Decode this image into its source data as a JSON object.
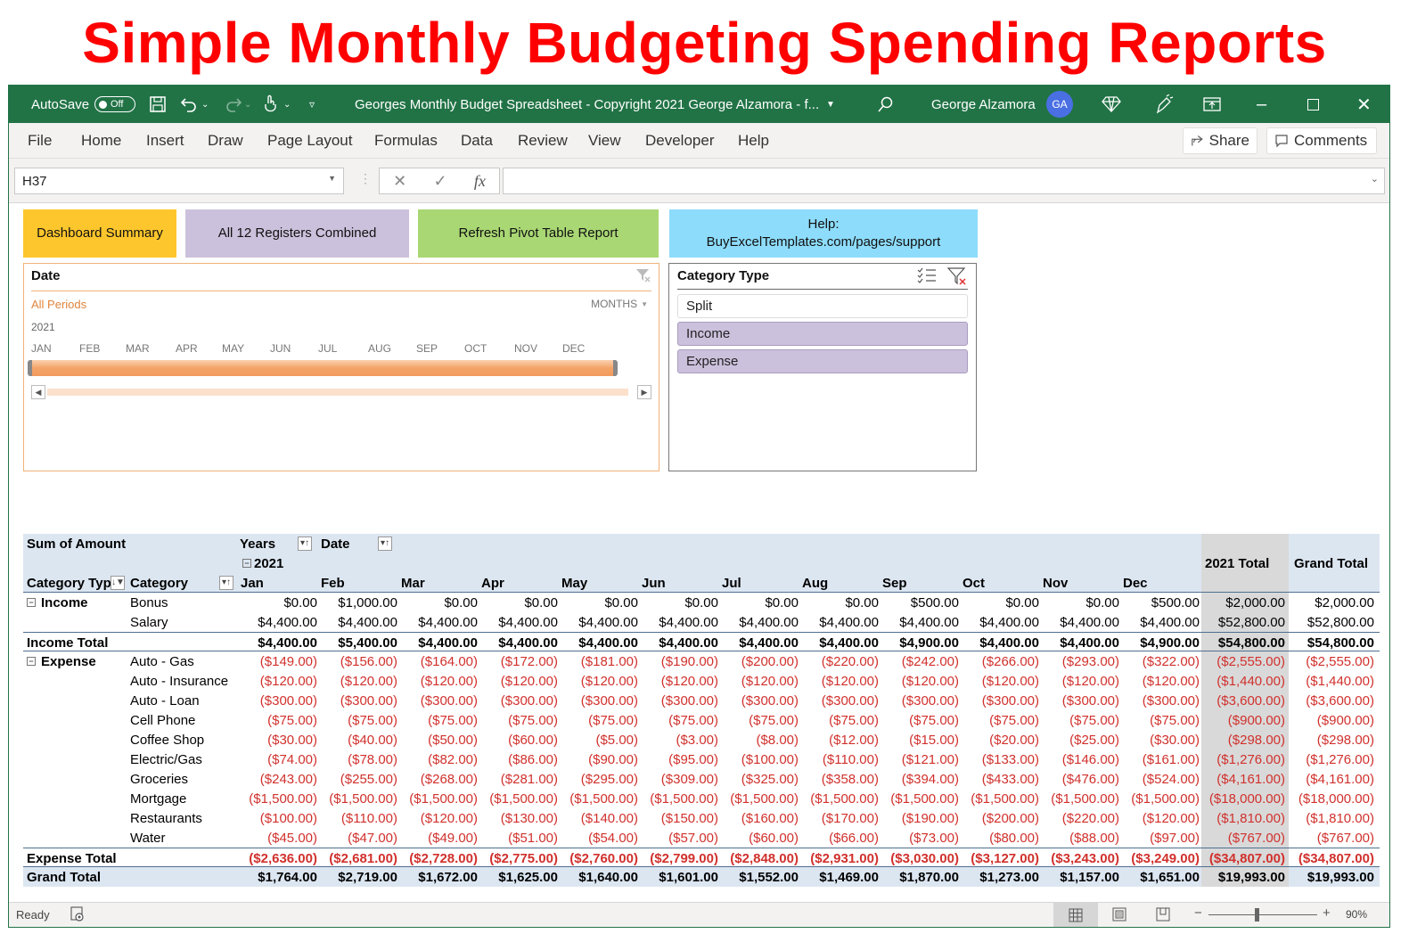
{
  "banner": {
    "title": "Simple Monthly Budgeting Spending Reports",
    "color": "#ff0000"
  },
  "titlebar": {
    "autosave_label": "AutoSave",
    "autosave_state": "Off",
    "document_title": "Georges Monthly Budget Spreadsheet - Copyright 2021 George Alzamora - f...",
    "user_name": "George Alzamora",
    "user_initials": "GA",
    "accent": "#217346"
  },
  "ribbon": {
    "tabs": [
      "File",
      "Home",
      "Insert",
      "Draw",
      "Page Layout",
      "Formulas",
      "Data",
      "Review",
      "View",
      "Developer",
      "Help"
    ],
    "share_label": "Share",
    "comments_label": "Comments"
  },
  "formula_bar": {
    "name_box": "H37",
    "fx_label": "fx",
    "formula": ""
  },
  "buttons": {
    "dashboard": "Dashboard Summary",
    "registers": "All 12 Registers Combined",
    "refresh": "Refresh Pivot Table Report",
    "help_line1": "Help:",
    "help_line2": "BuyExcelTemplates.com/pages/support"
  },
  "date_slicer": {
    "title": "Date",
    "selection": "All Periods",
    "level": "MONTHS",
    "year": "2021",
    "months": [
      "JAN",
      "FEB",
      "MAR",
      "APR",
      "MAY",
      "JUN",
      "JUL",
      "AUG",
      "SEP",
      "OCT",
      "NOV",
      "DEC"
    ],
    "selected_range": "JAN-DEC"
  },
  "category_slicer": {
    "title": "Category Type",
    "items": [
      {
        "label": "Split",
        "selected": false
      },
      {
        "label": "Income",
        "selected": true
      },
      {
        "label": "Expense",
        "selected": true
      }
    ]
  },
  "pivot": {
    "value_label": "Sum of Amount",
    "years_label": "Years",
    "date_label": "Date",
    "year": "2021",
    "row_header_1": "Category Typ",
    "row_header_2": "Category",
    "months": [
      "Jan",
      "Feb",
      "Mar",
      "Apr",
      "May",
      "Jun",
      "Jul",
      "Aug",
      "Sep",
      "Oct",
      "Nov",
      "Dec"
    ],
    "year_total_label": "2021 Total",
    "grand_total_label": "Grand Total",
    "groups": [
      {
        "name": "Income",
        "rows": [
          {
            "category": "Bonus",
            "values": [
              "$0.00",
              "$1,000.00",
              "$0.00",
              "$0.00",
              "$0.00",
              "$0.00",
              "$0.00",
              "$0.00",
              "$500.00",
              "$0.00",
              "$0.00",
              "$500.00"
            ],
            "year_total": "$2,000.00",
            "grand_total": "$2,000.00"
          },
          {
            "category": "Salary",
            "values": [
              "$4,400.00",
              "$4,400.00",
              "$4,400.00",
              "$4,400.00",
              "$4,400.00",
              "$4,400.00",
              "$4,400.00",
              "$4,400.00",
              "$4,400.00",
              "$4,400.00",
              "$4,400.00",
              "$4,400.00"
            ],
            "year_total": "$52,800.00",
            "grand_total": "$52,800.00"
          }
        ],
        "total_label": "Income Total",
        "total": {
          "values": [
            "$4,400.00",
            "$5,400.00",
            "$4,400.00",
            "$4,400.00",
            "$4,400.00",
            "$4,400.00",
            "$4,400.00",
            "$4,400.00",
            "$4,900.00",
            "$4,400.00",
            "$4,400.00",
            "$4,900.00"
          ],
          "year_total": "$54,800.00",
          "grand_total": "$54,800.00"
        },
        "negative": false
      },
      {
        "name": "Expense",
        "rows": [
          {
            "category": "Auto - Gas",
            "values": [
              "($149.00)",
              "($156.00)",
              "($164.00)",
              "($172.00)",
              "($181.00)",
              "($190.00)",
              "($200.00)",
              "($220.00)",
              "($242.00)",
              "($266.00)",
              "($293.00)",
              "($322.00)"
            ],
            "year_total": "($2,555.00)",
            "grand_total": "($2,555.00)"
          },
          {
            "category": "Auto - Insurance",
            "values": [
              "($120.00)",
              "($120.00)",
              "($120.00)",
              "($120.00)",
              "($120.00)",
              "($120.00)",
              "($120.00)",
              "($120.00)",
              "($120.00)",
              "($120.00)",
              "($120.00)",
              "($120.00)"
            ],
            "year_total": "($1,440.00)",
            "grand_total": "($1,440.00)"
          },
          {
            "category": "Auto - Loan",
            "values": [
              "($300.00)",
              "($300.00)",
              "($300.00)",
              "($300.00)",
              "($300.00)",
              "($300.00)",
              "($300.00)",
              "($300.00)",
              "($300.00)",
              "($300.00)",
              "($300.00)",
              "($300.00)"
            ],
            "year_total": "($3,600.00)",
            "grand_total": "($3,600.00)"
          },
          {
            "category": "Cell Phone",
            "values": [
              "($75.00)",
              "($75.00)",
              "($75.00)",
              "($75.00)",
              "($75.00)",
              "($75.00)",
              "($75.00)",
              "($75.00)",
              "($75.00)",
              "($75.00)",
              "($75.00)",
              "($75.00)"
            ],
            "year_total": "($900.00)",
            "grand_total": "($900.00)"
          },
          {
            "category": "Coffee Shop",
            "values": [
              "($30.00)",
              "($40.00)",
              "($50.00)",
              "($60.00)",
              "($5.00)",
              "($3.00)",
              "($8.00)",
              "($12.00)",
              "($15.00)",
              "($20.00)",
              "($25.00)",
              "($30.00)"
            ],
            "year_total": "($298.00)",
            "grand_total": "($298.00)"
          },
          {
            "category": "Electric/Gas",
            "values": [
              "($74.00)",
              "($78.00)",
              "($82.00)",
              "($86.00)",
              "($90.00)",
              "($95.00)",
              "($100.00)",
              "($110.00)",
              "($121.00)",
              "($133.00)",
              "($146.00)",
              "($161.00)"
            ],
            "year_total": "($1,276.00)",
            "grand_total": "($1,276.00)"
          },
          {
            "category": "Groceries",
            "values": [
              "($243.00)",
              "($255.00)",
              "($268.00)",
              "($281.00)",
              "($295.00)",
              "($309.00)",
              "($325.00)",
              "($358.00)",
              "($394.00)",
              "($433.00)",
              "($476.00)",
              "($524.00)"
            ],
            "year_total": "($4,161.00)",
            "grand_total": "($4,161.00)"
          },
          {
            "category": "Mortgage",
            "values": [
              "($1,500.00)",
              "($1,500.00)",
              "($1,500.00)",
              "($1,500.00)",
              "($1,500.00)",
              "($1,500.00)",
              "($1,500.00)",
              "($1,500.00)",
              "($1,500.00)",
              "($1,500.00)",
              "($1,500.00)",
              "($1,500.00)"
            ],
            "year_total": "($18,000.00)",
            "grand_total": "($18,000.00)"
          },
          {
            "category": "Restaurants",
            "values": [
              "($100.00)",
              "($110.00)",
              "($120.00)",
              "($130.00)",
              "($140.00)",
              "($150.00)",
              "($160.00)",
              "($170.00)",
              "($190.00)",
              "($200.00)",
              "($220.00)",
              "($120.00)"
            ],
            "year_total": "($1,810.00)",
            "grand_total": "($1,810.00)"
          },
          {
            "category": "Water",
            "values": [
              "($45.00)",
              "($47.00)",
              "($49.00)",
              "($51.00)",
              "($54.00)",
              "($57.00)",
              "($60.00)",
              "($66.00)",
              "($73.00)",
              "($80.00)",
              "($88.00)",
              "($97.00)"
            ],
            "year_total": "($767.00)",
            "grand_total": "($767.00)"
          }
        ],
        "total_label": "Expense Total",
        "total": {
          "values": [
            "($2,636.00)",
            "($2,681.00)",
            "($2,728.00)",
            "($2,775.00)",
            "($2,760.00)",
            "($2,799.00)",
            "($2,848.00)",
            "($2,931.00)",
            "($3,030.00)",
            "($3,127.00)",
            "($3,243.00)",
            "($3,249.00)"
          ],
          "year_total": "($34,807.00)",
          "grand_total": "($34,807.00)"
        },
        "negative": true
      }
    ],
    "grand_total_row": {
      "label": "Grand Total",
      "values": [
        "$1,764.00",
        "$2,719.00",
        "$1,672.00",
        "$1,625.00",
        "$1,640.00",
        "$1,601.00",
        "$1,552.00",
        "$1,469.00",
        "$1,870.00",
        "$1,273.00",
        "$1,157.00",
        "$1,651.00"
      ],
      "year_total": "$19,993.00",
      "grand_total": "$19,993.00"
    },
    "colors": {
      "header_bg": "#dce6f1",
      "year_total_bg": "#d9d9d9",
      "negative": "#d0312d"
    }
  },
  "status_bar": {
    "status": "Ready",
    "zoom": "90%",
    "zoom_percent": 90
  }
}
